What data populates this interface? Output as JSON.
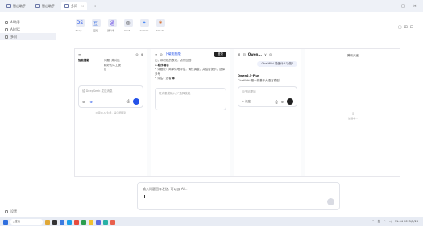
{
  "window": {
    "tabs": [
      {
        "label": "智山助手"
      },
      {
        "label": "智山助手"
      },
      {
        "label": "多问"
      }
    ],
    "new_tab": "+",
    "controls": [
      "-",
      "□",
      "×"
    ]
  },
  "sidebar": {
    "items": [
      {
        "label": "AI助手"
      },
      {
        "label": "AI对话"
      },
      {
        "label": "多问"
      }
    ],
    "settings_label": "设置"
  },
  "apps": [
    {
      "name": "Deep...",
      "icon": "DS"
    },
    {
      "name": "豆包",
      "icon": "豆"
    },
    {
      "name": "通义千...",
      "icon": "通"
    },
    {
      "name": "Chat...",
      "icon": "◎"
    },
    {
      "name": "Gemini",
      "icon": "✦"
    },
    {
      "name": "Claude",
      "icon": "✱"
    }
  ],
  "right_controls": [
    "▢",
    "⊞",
    "⊟"
  ],
  "panes": {
    "p1": {
      "head_icons": [
        "≡",
        "⊙",
        "⊕"
      ],
      "title": "智能體驗",
      "lines": [
        "问题, 并对比",
        "精好的人工提",
        "目"
      ],
      "input_placeholder": "给 DeepSeek 发送消息",
      "footer_note": "内容由 AI 生成，请仔细甄别"
    },
    "p2": {
      "head": [
        "≡",
        "⊙",
        "下载电脑版",
        "登录"
      ],
      "login_label": "登录",
      "intro": "化，和积极的表现，点赞回答",
      "section_title": "3.程序请求",
      "bullets": [
        "详细说：简单化地评估，清性调整，并结合提示，选择多号",
        "评估：选者 ●"
      ],
      "input_placeholder": "发消息或输入\"/\"选择技能"
    },
    "p3": {
      "head": [
        "⊞",
        "⊟",
        "Qwen...",
        "∨",
        "⊙"
      ],
      "question_pill": "ChatWiki 能做什么功能?",
      "model_name": "Qwen2.5-Plus",
      "answer": "ChatWiki 是一款基于大语言模型",
      "input_placeholder": "向千问提问",
      "toggle_label": "深度"
    },
    "p4": {
      "title": "腾讯元宝",
      "status": "加载中..."
    }
  },
  "composer": {
    "placeholder": "输入问题回车发送, 可以@ AI..."
  },
  "taskbar": {
    "search_label": "搜索",
    "tray_lang": "英",
    "tray_time": "11:04",
    "tray_date": "2025/2/28"
  }
}
